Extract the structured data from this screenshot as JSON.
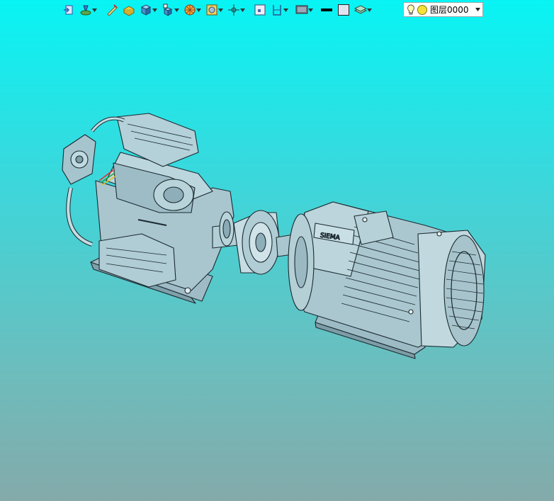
{
  "toolbar": {
    "buttons": [
      {
        "icon": "exit-sketch-icon",
        "has_menu": false
      },
      {
        "icon": "filter-icon",
        "has_menu": true
      },
      {
        "icon": "measure-icon",
        "has_menu": false
      },
      {
        "icon": "box-select-icon",
        "has_menu": false
      },
      {
        "icon": "cube-display-icon",
        "has_menu": true
      },
      {
        "icon": "view-orient-icon",
        "has_menu": true
      },
      {
        "icon": "render-style-icon",
        "has_menu": true
      },
      {
        "icon": "section-view-icon",
        "has_menu": true
      },
      {
        "icon": "axis-triad-icon",
        "has_menu": true
      },
      {
        "icon": "fit-all-icon",
        "has_menu": false
      },
      {
        "icon": "zoom-area-icon",
        "has_menu": true
      },
      {
        "icon": "monitor-icon",
        "has_menu": true
      },
      {
        "icon": "line-color-icon",
        "has_menu": false
      },
      {
        "icon": "fill-color-icon",
        "has_menu": false
      },
      {
        "icon": "layer-props-icon",
        "has_menu": true
      }
    ]
  },
  "layer": {
    "value": "图层0000"
  },
  "colors": {
    "bg_top": "#08f4f4",
    "bg_bottom": "#84aaaa",
    "model_fill": "#a9c6cf",
    "model_edge": "#1c2a30"
  }
}
